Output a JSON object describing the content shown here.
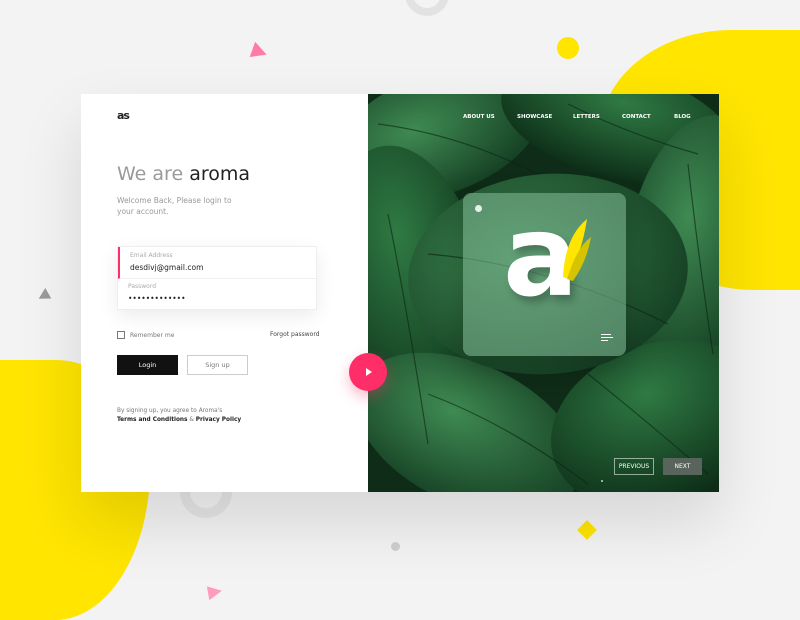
{
  "colors": {
    "accent_yellow": "#ffe500",
    "accent_pink": "#ff2e69",
    "dark": "#111111",
    "leaf_green": "#1c4a2a"
  },
  "brand": {
    "logo": "as"
  },
  "nav": [
    "ABOUT US",
    "SHOWCASE",
    "LETTERS",
    "CONTACT",
    "BLOG"
  ],
  "hero": {
    "headline_prefix": "We are",
    "headline_brand": "aroma",
    "welcome_text": "Welcome Back, Please login to your account."
  },
  "form": {
    "email_label": "Email Address",
    "email_value": "desdivj@gmail.com",
    "password_label": "Password",
    "password_value": "•••••••••••••",
    "remember_label": "Remember me",
    "forgot_label": "Forgot password",
    "login_label": "Login",
    "signup_label": "Sign up"
  },
  "terms": {
    "prefix": "By signing up, you agree to Aroma's",
    "terms_link": "Terms and Conditions",
    "amp": "&",
    "privacy_link": "Privacy Policy"
  },
  "logo_card": {
    "letter": "a",
    "menu_icon": "menu-icon"
  },
  "pager": {
    "previous_label": "PREVIOUS",
    "next_label": "NEXT"
  },
  "icons": {
    "play": "play-icon",
    "logo_dot": "dot-icon"
  }
}
